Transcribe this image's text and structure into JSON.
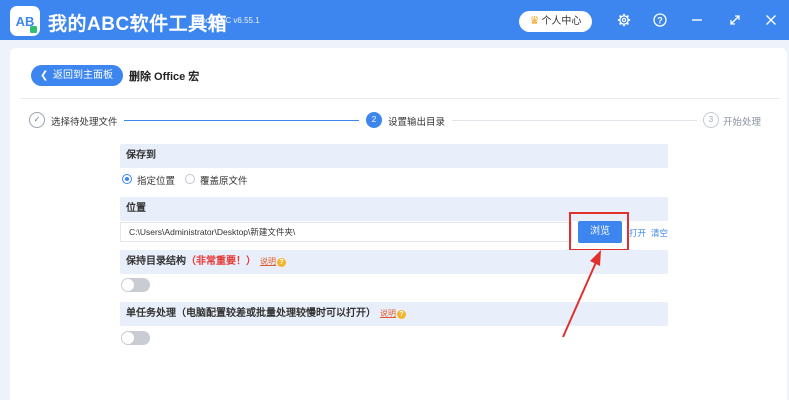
{
  "app": {
    "title": "我的ABC软件工具箱",
    "version": "WodeABC v6.55.1",
    "member_label": "个人中心",
    "logo_text": "AB"
  },
  "nav": {
    "back_label": "返回到主面板",
    "page_title": "删除 Office 宏"
  },
  "steps": [
    {
      "number": "✓",
      "label": "选择待处理文件",
      "state": "done"
    },
    {
      "number": "2",
      "label": "设置输出目录",
      "state": "active"
    },
    {
      "number": "3",
      "label": "开始处理",
      "state": "pending"
    }
  ],
  "save_to": {
    "heading": "保存到",
    "options": [
      {
        "label": "指定位置",
        "checked": true
      },
      {
        "label": "覆盖原文件",
        "checked": false
      }
    ]
  },
  "location": {
    "heading": "位置",
    "path": "C:\\Users\\Administrator\\Desktop\\新建文件夹\\",
    "browse_label": "浏览",
    "open_label": "打开",
    "clear_label": "清空"
  },
  "keep_structure": {
    "heading": "保持目录结构",
    "note": "（非常重要！）",
    "help_label": "说明",
    "enabled": false
  },
  "single_task": {
    "heading": "单任务处理（电脑配置较差或批量处理较慢时可以打开）",
    "help_label": "说明",
    "enabled": false
  },
  "colors": {
    "accent": "#3d86f0",
    "highlight": "#e0302e",
    "panel": "#e9effa",
    "background": "#eef3fb"
  }
}
